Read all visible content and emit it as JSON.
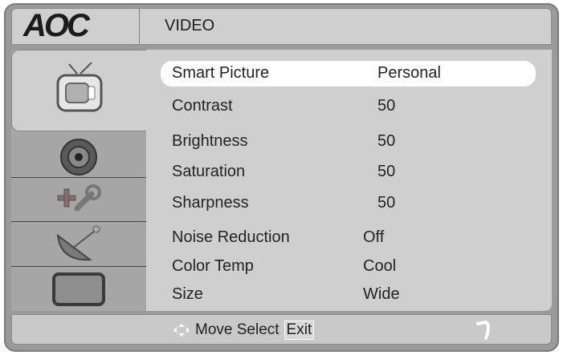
{
  "header": {
    "brand": "AOC",
    "title": "VIDEO"
  },
  "sidebar": {
    "tabs": [
      {
        "name": "picture",
        "icon": "tv-icon",
        "active": true
      },
      {
        "name": "sound",
        "icon": "speaker-icon",
        "active": false
      },
      {
        "name": "setup",
        "icon": "tools-icon",
        "active": false
      },
      {
        "name": "channel",
        "icon": "satellite-dish-icon",
        "active": false
      },
      {
        "name": "screen",
        "icon": "monitor-icon",
        "active": false
      }
    ]
  },
  "menu": {
    "items": [
      {
        "label": "Smart Picture",
        "value": "Personal",
        "selected": true
      },
      {
        "label": "Contrast",
        "value": "50"
      },
      {
        "label": "Brightness",
        "value": "50"
      },
      {
        "label": "Saturation",
        "value": "50"
      },
      {
        "label": "Sharpness",
        "value": "50"
      },
      {
        "label": "Noise Reduction",
        "value": "Off"
      },
      {
        "label": "Color Temp",
        "value": "Cool"
      },
      {
        "label": "Size",
        "value": "Wide"
      }
    ]
  },
  "footer": {
    "move_select": "Move Select",
    "exit": "Exit"
  },
  "colors": {
    "frame": "#9a9a9a",
    "panel": "#cfcfcf",
    "selected_row": "#ffffff",
    "text": "#232323"
  }
}
